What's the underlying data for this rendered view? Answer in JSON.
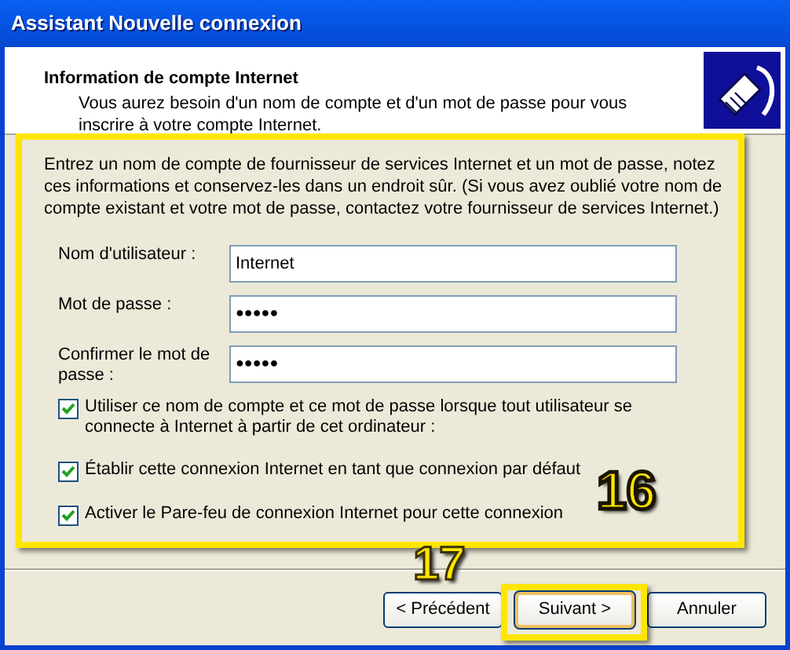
{
  "window": {
    "title": "Assistant Nouvelle connexion"
  },
  "header": {
    "title": "Information de compte Internet",
    "subtitle": "Vous aurez besoin d'un nom de compte et d'un mot de passe pour vous inscrire à votre compte Internet."
  },
  "instructions": "Entrez un nom de compte de fournisseur de services Internet et un mot de passe, notez ces informations et conservez-les dans un endroit sûr. (Si vous avez oublié votre nom de compte existant et votre mot de passe, contactez votre fournisseur de services Internet.)",
  "fields": [
    {
      "label": "Nom d'utilisateur :",
      "value": "Internet",
      "kind": "text"
    },
    {
      "label": "Mot de passe :",
      "value": "●●●●●",
      "kind": "password"
    },
    {
      "label": "Confirmer le mot de passe :",
      "value": "●●●●●",
      "kind": "password"
    }
  ],
  "options": [
    {
      "label": "Utiliser ce nom de compte et ce mot de passe lorsque tout utilisateur se connecte à Internet à partir de cet ordinateur :",
      "checked": true
    },
    {
      "label": "Établir cette connexion Internet en tant que connexion par défaut",
      "checked": true
    },
    {
      "label": "Activer le Pare-feu de connexion Internet pour cette connexion",
      "checked": true
    }
  ],
  "buttons": [
    {
      "label": "< Précédent",
      "selected": false
    },
    {
      "label": "Suivant >",
      "selected": true
    },
    {
      "label": "Annuler",
      "selected": false
    }
  ],
  "annotations": [
    {
      "label": "16"
    },
    {
      "label": "17"
    }
  ]
}
